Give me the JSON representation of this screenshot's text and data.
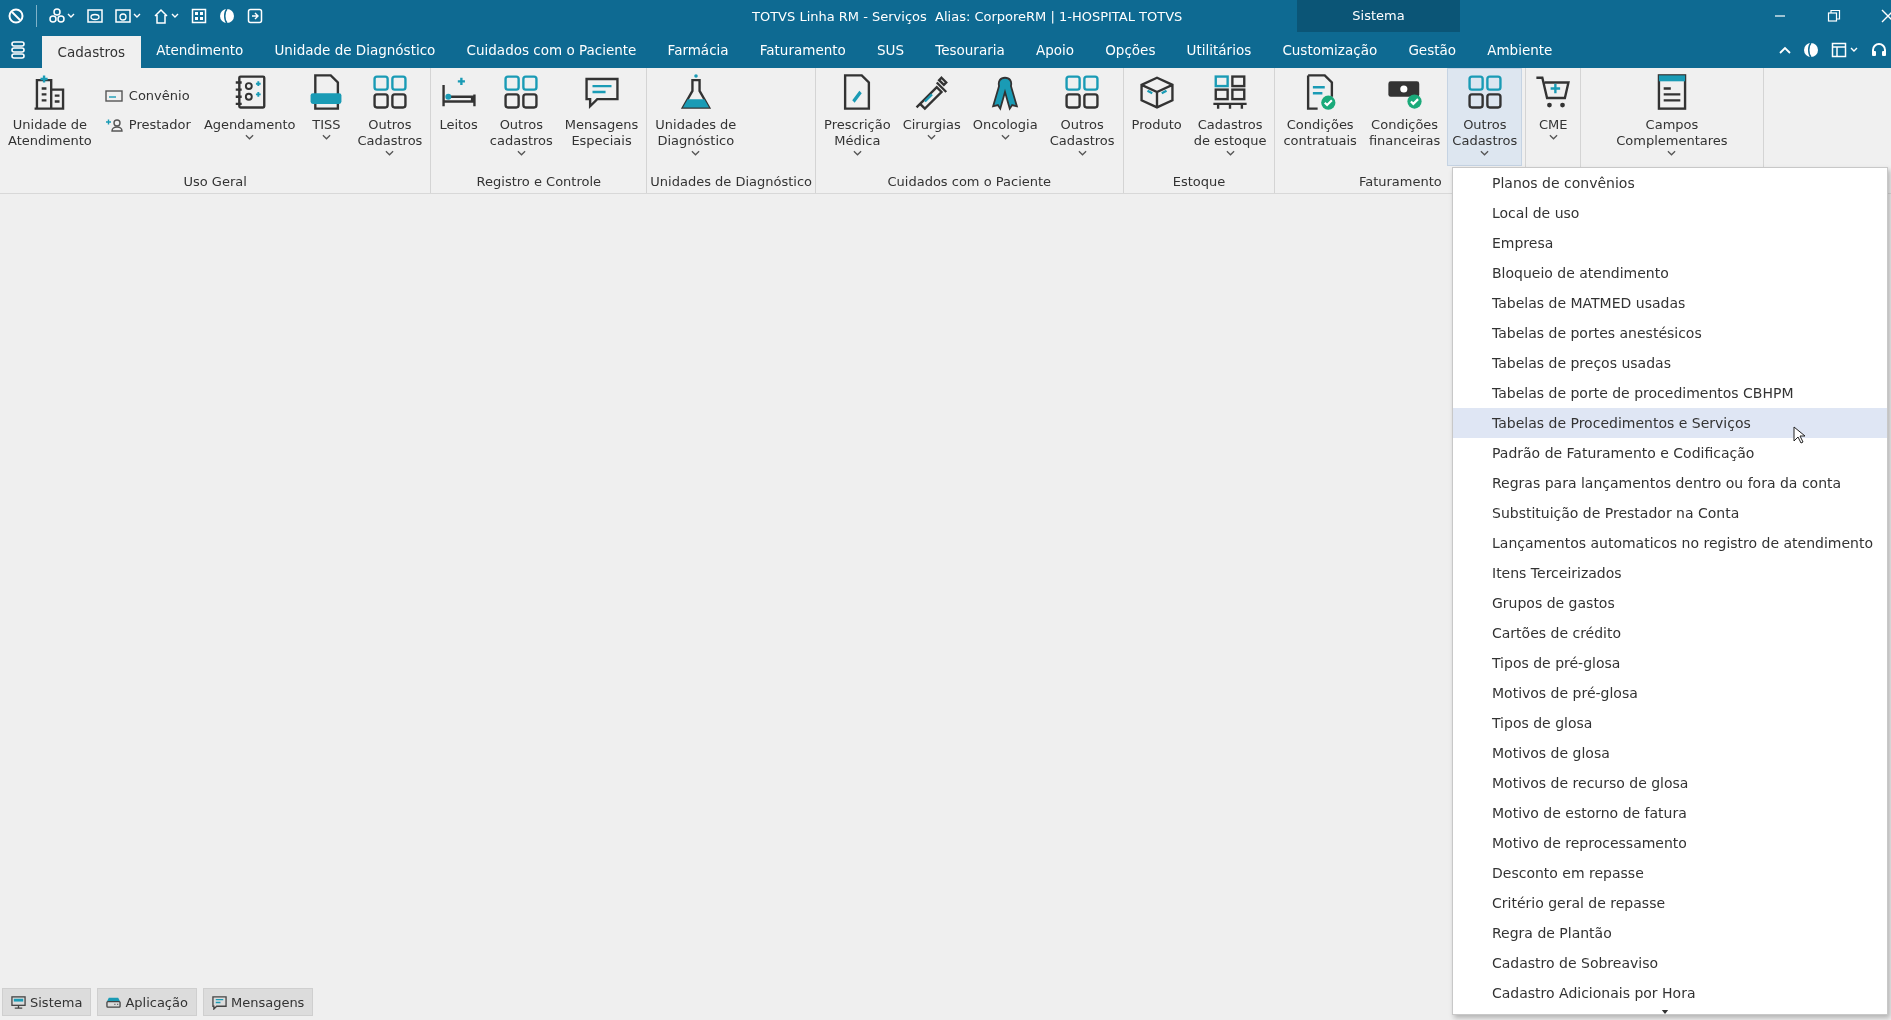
{
  "title_bar": {
    "title": "TOTVS Linha RM - Serviços  Alias: CorporeRM | 1-HOSPITAL TOTVS",
    "context_tab": "Sistema"
  },
  "tabs": [
    {
      "label": "Cadastros",
      "selected": true
    },
    {
      "label": "Atendimento",
      "selected": false
    },
    {
      "label": "Unidade de Diagnóstico",
      "selected": false
    },
    {
      "label": "Cuidados com o Paciente",
      "selected": false
    },
    {
      "label": "Farmácia",
      "selected": false
    },
    {
      "label": "Faturamento",
      "selected": false
    },
    {
      "label": "SUS",
      "selected": false
    },
    {
      "label": "Tesouraria",
      "selected": false
    },
    {
      "label": "Apoio",
      "selected": false
    },
    {
      "label": "Opções",
      "selected": false
    },
    {
      "label": "Utilitários",
      "selected": false
    },
    {
      "label": "Customização",
      "selected": false
    },
    {
      "label": "Gestão",
      "selected": false
    },
    {
      "label": "Ambiente",
      "selected": false
    }
  ],
  "ribbon_groups": [
    {
      "label": "Uso Geral",
      "buttons": [
        {
          "kind": "large",
          "label": "Unidade de\nAtendimento",
          "dropdown": false,
          "open": false
        },
        {
          "kind": "stack",
          "items": [
            "Convênio",
            "Prestador"
          ]
        },
        {
          "kind": "large",
          "label": "Agendamento",
          "dropdown": true,
          "open": false
        },
        {
          "kind": "large",
          "label": "TISS",
          "dropdown": true,
          "open": false
        },
        {
          "kind": "large",
          "label": "Outros\nCadastros",
          "dropdown": true,
          "open": false
        }
      ]
    },
    {
      "label": "Registro e Controle",
      "buttons": [
        {
          "kind": "large",
          "label": "Leitos",
          "dropdown": false,
          "open": false
        },
        {
          "kind": "large",
          "label": "Outros\ncadastros",
          "dropdown": true,
          "open": false
        },
        {
          "kind": "large",
          "label": "Mensagens\nEspeciais",
          "dropdown": false,
          "open": false
        }
      ]
    },
    {
      "label": "Unidades de Diagnóstico",
      "buttons": [
        {
          "kind": "large",
          "label": "Unidades de\nDiagnóstico",
          "dropdown": true,
          "open": false
        }
      ]
    },
    {
      "label": "Cuidados com o Paciente",
      "buttons": [
        {
          "kind": "large",
          "label": "Prescrição\nMédica",
          "dropdown": true,
          "open": false
        },
        {
          "kind": "large",
          "label": "Cirurgias",
          "dropdown": true,
          "open": false
        },
        {
          "kind": "large",
          "label": "Oncologia",
          "dropdown": true,
          "open": false
        },
        {
          "kind": "large",
          "label": "Outros\nCadastros",
          "dropdown": true,
          "open": false
        }
      ]
    },
    {
      "label": "Estoque",
      "buttons": [
        {
          "kind": "large",
          "label": "Produto",
          "dropdown": false,
          "open": false
        },
        {
          "kind": "large",
          "label": "Cadastros\nde estoque",
          "dropdown": true,
          "open": false
        }
      ]
    },
    {
      "label": "Faturamento",
      "buttons": [
        {
          "kind": "large",
          "label": "Condições\ncontratuais",
          "dropdown": false,
          "open": false
        },
        {
          "kind": "large",
          "label": "Condições\nfinanceiras",
          "dropdown": false,
          "open": false
        },
        {
          "kind": "large",
          "label": "Outros\nCadastros",
          "dropdown": true,
          "open": true
        }
      ]
    },
    {
      "buttons": [
        {
          "kind": "large",
          "label": "CME",
          "dropdown": true,
          "open": false
        }
      ]
    },
    {
      "buttons": [
        {
          "kind": "large",
          "label": "Campos\nComplementares",
          "dropdown": true,
          "open": false
        }
      ]
    }
  ],
  "dropdown_menu": {
    "items": [
      {
        "label": "Planos de convênios",
        "selected": false
      },
      {
        "label": "Local de uso",
        "selected": false
      },
      {
        "label": "Empresa",
        "selected": false
      },
      {
        "label": "Bloqueio de atendimento",
        "selected": false
      },
      {
        "label": "Tabelas de MATMED usadas",
        "selected": false
      },
      {
        "label": "Tabelas de portes anestésicos",
        "selected": false
      },
      {
        "label": "Tabelas de preços usadas",
        "selected": false
      },
      {
        "label": "Tabelas de porte de procedimentos CBHPM",
        "selected": false
      },
      {
        "label": "Tabelas de Procedimentos e Serviços",
        "selected": true
      },
      {
        "label": "Padrão de Faturamento e Codificação",
        "selected": false
      },
      {
        "label": "Regras para lançamentos dentro ou fora da conta",
        "selected": false
      },
      {
        "label": "Substituição de Prestador na Conta",
        "selected": false
      },
      {
        "label": "Lançamentos automaticos no registro de atendimento",
        "selected": false
      },
      {
        "label": "Itens Terceirizados",
        "selected": false
      },
      {
        "label": "Grupos de gastos",
        "selected": false
      },
      {
        "label": "Cartões de crédito",
        "selected": false
      },
      {
        "label": "Tipos de pré-glosa",
        "selected": false
      },
      {
        "label": "Motivos de pré-glosa",
        "selected": false
      },
      {
        "label": "Tipos de glosa",
        "selected": false
      },
      {
        "label": "Motivos de glosa",
        "selected": false
      },
      {
        "label": "Motivos de recurso de glosa",
        "selected": false
      },
      {
        "label": "Motivo de estorno de fatura",
        "selected": false
      },
      {
        "label": "Motivo de reprocessamento",
        "selected": false
      },
      {
        "label": "Desconto em repasse",
        "selected": false
      },
      {
        "label": "Critério geral de repasse",
        "selected": false
      },
      {
        "label": "Regra de Plantão",
        "selected": false
      },
      {
        "label": "Cadastro de Sobreaviso",
        "selected": false
      },
      {
        "label": "Cadastro Adicionais por Hora",
        "selected": false
      }
    ]
  },
  "bottom_tabs": [
    "Sistema",
    "Aplicação",
    "Mensagens"
  ]
}
